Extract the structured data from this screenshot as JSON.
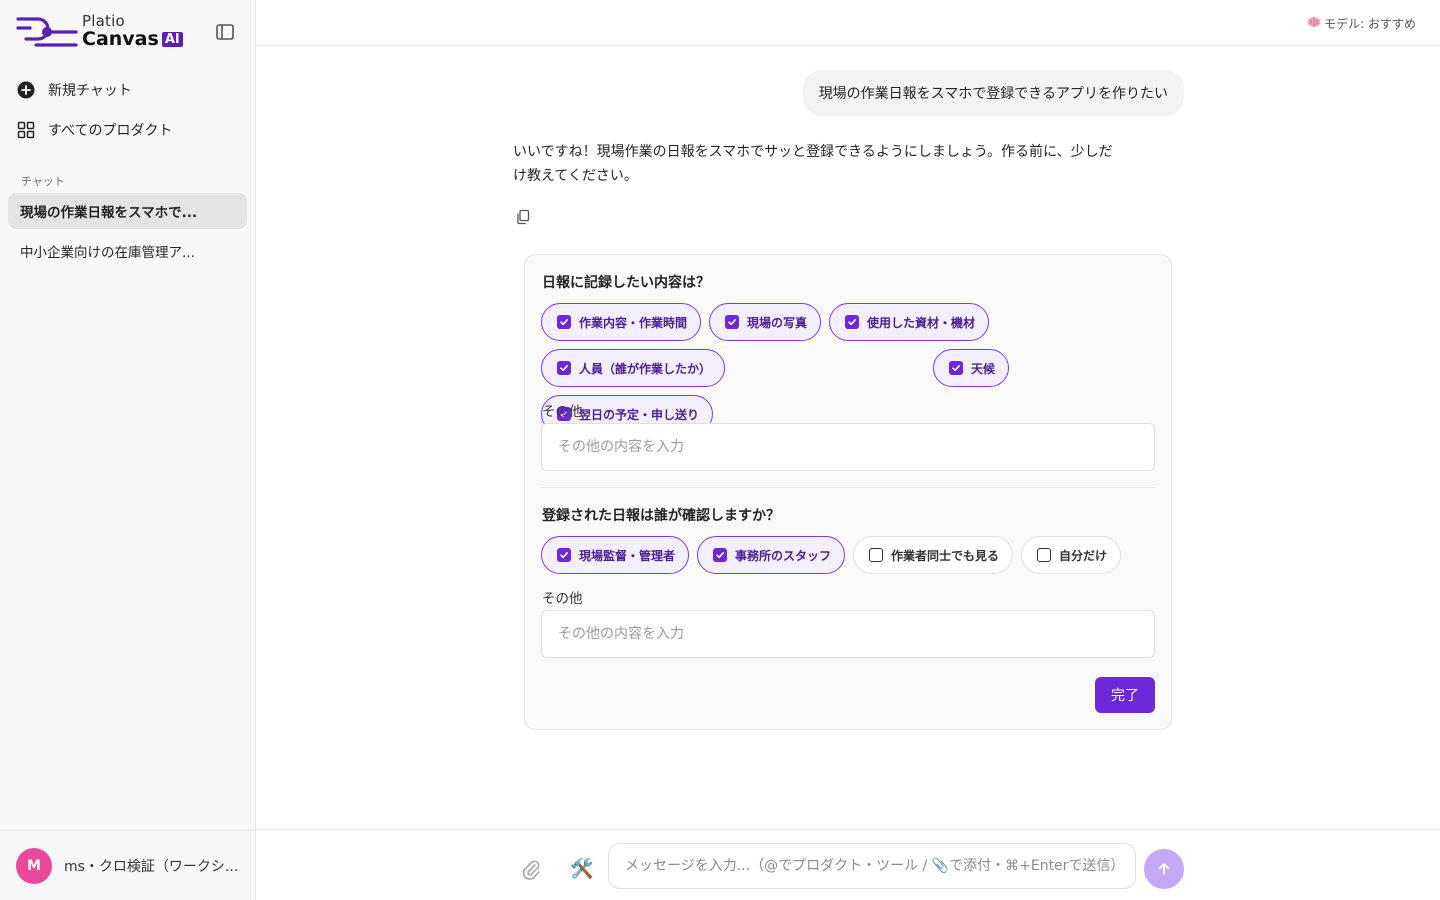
{
  "app": {
    "logo_small": "Platio",
    "logo_big": "Canvas",
    "logo_badge": "AI"
  },
  "sidebar": {
    "nav": [
      {
        "label": "新規チャット",
        "icon": "plus-circle-icon"
      },
      {
        "label": "すべてのプロダクト",
        "icon": "grid-icon"
      }
    ],
    "section_label": "チャット",
    "chats": [
      {
        "label": "現場の作業日報をスマホで...",
        "active": true
      },
      {
        "label": "中小企業向けの在庫管理ア...",
        "active": false
      }
    ],
    "user": {
      "initial": "M",
      "name": "ms・クロ検証（ワークシ..."
    }
  },
  "topbar": {
    "model_label": "モデル: おすすめ",
    "model_icon": "brain-icon"
  },
  "conversation": {
    "user_message": "現場の作業日報をスマホで登録できるアプリを作りたい",
    "assistant_message": "いいですね！現場作業の日報をスマホでサッと登録できるようにしましょう。作る前に、少しだけ教えてください。"
  },
  "form": {
    "q1": {
      "title": "日報に記録したい内容は？",
      "options": [
        {
          "label": "作業内容・作業時間",
          "checked": true
        },
        {
          "label": "現場の写真",
          "checked": true
        },
        {
          "label": "使用した資材・機材",
          "checked": true
        },
        {
          "label": "人員（誰が作業したか）",
          "checked": true
        },
        {
          "label": "天候",
          "checked": true
        },
        {
          "label": "翌日の予定・申し送り",
          "checked": true
        }
      ],
      "other_label": "その他",
      "other_placeholder": "その他の内容を入力"
    },
    "q2": {
      "title": "登録された日報は誰が確認しますか？",
      "options": [
        {
          "label": "現場監督・管理者",
          "checked": true
        },
        {
          "label": "事務所のスタッフ",
          "checked": true
        },
        {
          "label": "作業者同士でも見る",
          "checked": false
        },
        {
          "label": "自分だけ",
          "checked": false
        }
      ],
      "other_label": "その他",
      "other_placeholder": "その他の内容を入力"
    },
    "submit_label": "完了"
  },
  "composer": {
    "placeholder": "メッセージを入力...（@でプロダクト・ツール / 📎で添付・⌘+Enterで送信）",
    "tools_icon": "🛠️"
  },
  "colors": {
    "accent": "#6d28d9",
    "chip_bg": "#f4efff",
    "avatar": "#ec4899",
    "send_disabled": "#c4a7f5"
  }
}
